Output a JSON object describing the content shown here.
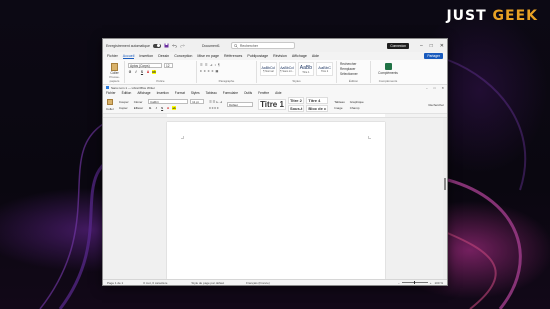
{
  "brand": {
    "part1": "JUST",
    "part2": "GEEK"
  },
  "word": {
    "autosave_label": "Enregistrement automatique",
    "doc_title": "Document1",
    "search_placeholder": "Rechercher",
    "connect_label": "Connexion",
    "menu": [
      "Fichier",
      "Accueil",
      "Insertion",
      "Dessin",
      "Conception",
      "Mise en page",
      "Références",
      "Publipostage",
      "Révision",
      "Affichage",
      "Aide"
    ],
    "active_menu_index": 1,
    "share_label": "Partager",
    "ribbon": {
      "paste_label": "Coller",
      "clipboard_group": "Presse-papiers",
      "font_name": "Aptos (Corps)",
      "font_size": "12",
      "font_group": "Police",
      "paragraph_group": "Paragraphe",
      "styles_group": "Styles",
      "styles": [
        {
          "preview": "AaBbCcI",
          "name": "¶ Normal"
        },
        {
          "preview": "AaBbCcI",
          "name": "¶ Sans int..."
        },
        {
          "preview": "AaBb",
          "name": "Titre 1"
        },
        {
          "preview": "AaBbC",
          "name": "Titre 2"
        }
      ],
      "edit_items": [
        "Rechercher",
        "Remplacer",
        "Sélectionner"
      ],
      "edit_group": "Édition",
      "addins_label": "Compléments",
      "addins_group": "Compléments"
    }
  },
  "writer": {
    "title": "Sans nom 1 — LibreOffice Writer",
    "menu": [
      "Fichier",
      "Édition",
      "Affichage",
      "Insertion",
      "Format",
      "Styles",
      "Tableau",
      "Formulaire",
      "Outils",
      "Fenêtre",
      "Aide"
    ],
    "toolbar": {
      "paste_label": "Coller",
      "cut_label": "Couper",
      "copy_label": "Copier",
      "clone_label": "Cloner",
      "clear_label": "Effacer",
      "font_name": "Calibri",
      "font_size": "11 pt",
      "style_name": "Défaut",
      "styles": [
        "Titre 1",
        "Titre 2",
        "Titre 4",
        "Titre 3",
        "Sous-t",
        "Bloc de c"
      ],
      "right_items": [
        "Tableau",
        "Image",
        "Graphique",
        "Champ"
      ],
      "search_label": "Rechercher"
    },
    "status": {
      "page": "Page 1 de 1",
      "words": "0 mot, 0 caractère",
      "page_style": "Style de page par défaut",
      "language": "Français (France)",
      "zoom": "100 %"
    }
  }
}
